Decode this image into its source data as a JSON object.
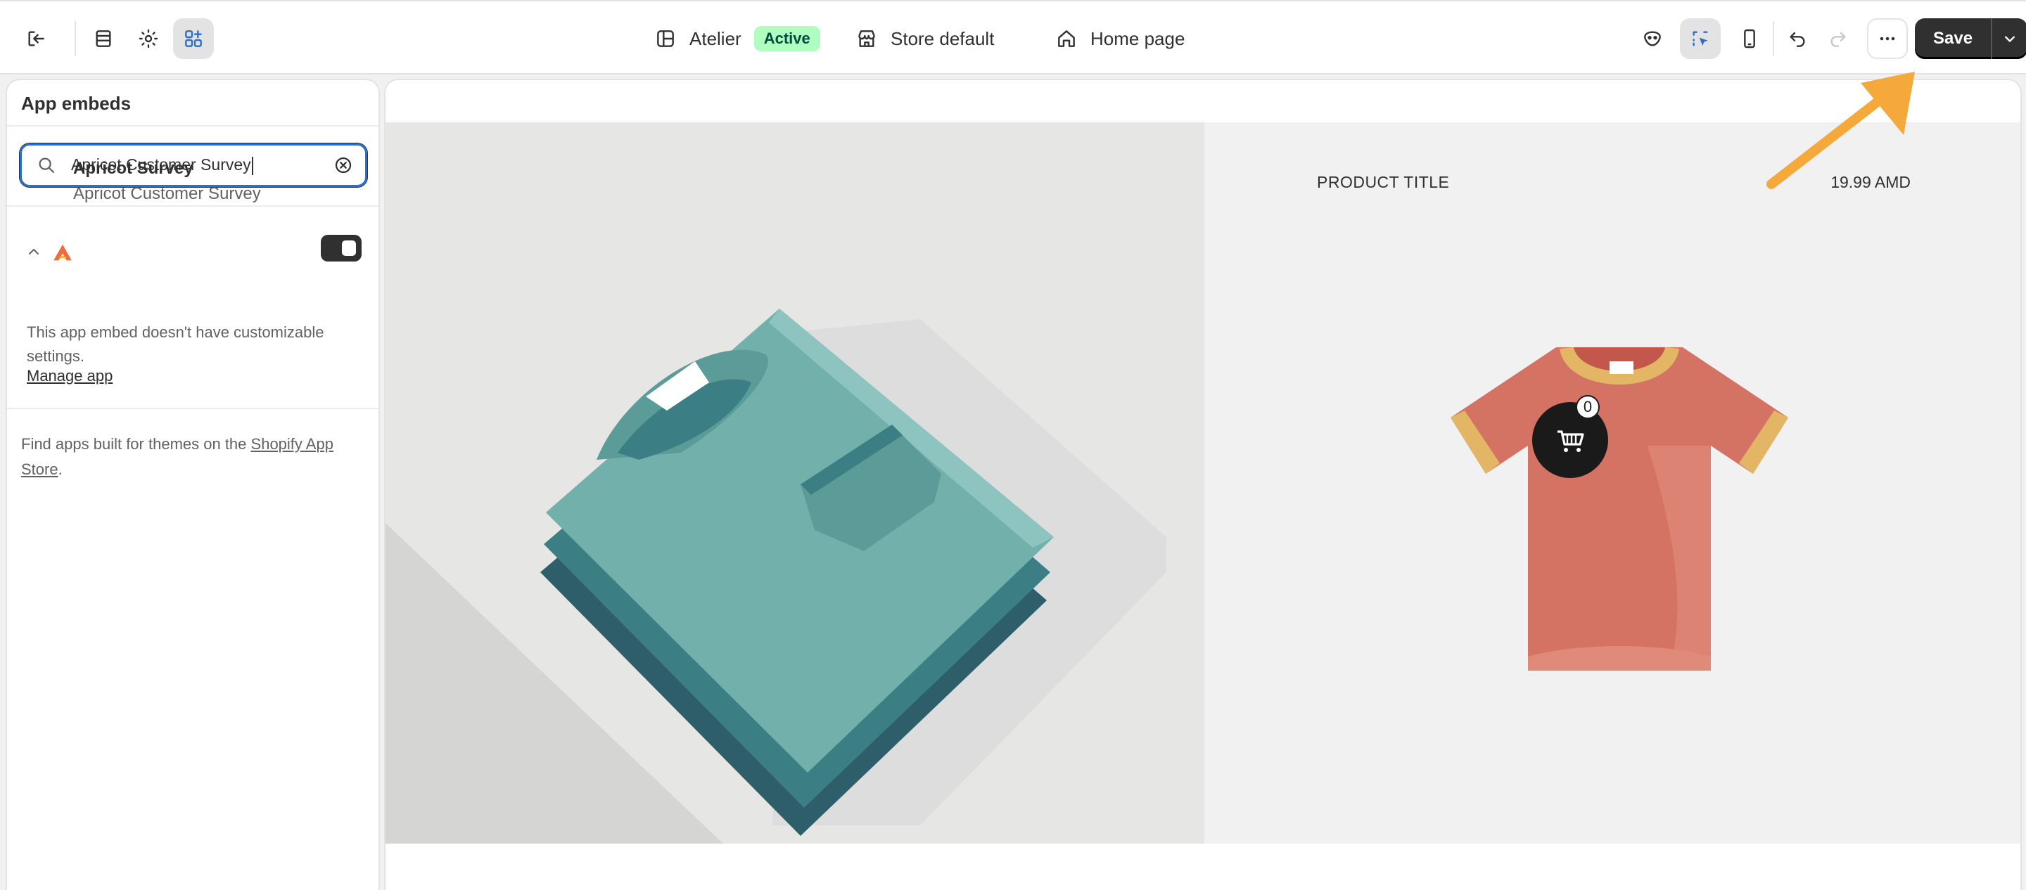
{
  "topbar": {
    "theme_name": "Atelier",
    "theme_status": "Active",
    "store_template": "Store default",
    "page": "Home page",
    "save_label": "Save"
  },
  "icons": {
    "exit": "exit-icon",
    "sections": "sections-icon",
    "settings": "gear-icon",
    "app_embeds": "app-embeds-icon",
    "theme": "layout-icon",
    "store": "store-icon",
    "home": "home-icon",
    "inspector": "inspector-icon",
    "select": "select-cursor-icon",
    "mobile": "mobile-icon",
    "undo": "undo-icon",
    "redo": "redo-icon",
    "more": "more-icon",
    "search": "search-icon",
    "clear": "clear-icon",
    "chevron": "chevron-up-icon",
    "cart": "cart-icon"
  },
  "sidebar": {
    "title": "App embeds",
    "search_value": "Apricot Customer Survey",
    "app": {
      "name": "Apricot Survey",
      "embed_name": "Apricot Customer Survey",
      "enabled": true
    },
    "note": "This app embed doesn't have customizable settings.",
    "manage_link": "Manage app",
    "find_prefix": "Find apps built for themes on the ",
    "find_link": "Shopify App Store",
    "find_suffix": "."
  },
  "preview": {
    "product_title": "PRODUCT TITLE",
    "product_price": "19.99 AMD",
    "cart_count": "0"
  },
  "colors": {
    "accent": "#2c6ecb",
    "badge_bg": "#affebf",
    "arrow": "#f5a93a",
    "primary_button": "#303030"
  }
}
